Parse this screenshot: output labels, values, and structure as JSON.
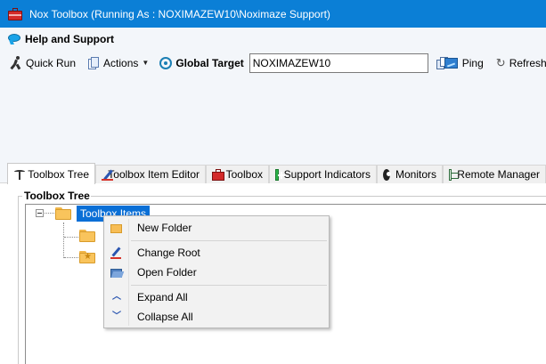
{
  "window": {
    "title": "Nox Toolbox (Running As : NOXIMAZEW10\\Noximaze Support)"
  },
  "menubar": {
    "help_label": "Help and Support"
  },
  "toolbar": {
    "quick_run": "Quick Run",
    "actions": "Actions",
    "global_target_label": "Global Target",
    "global_target_value": "NOXIMAZEW10",
    "ping": "Ping",
    "refresh": "Refresh"
  },
  "tabs": [
    {
      "label": "Toolbox Tree",
      "icon": "palm-tree-icon",
      "active": true
    },
    {
      "label": "Toolbox Item Editor",
      "icon": "pencil-icon"
    },
    {
      "label": "Toolbox",
      "icon": "toolbox-icon"
    },
    {
      "label": "Support Indicators",
      "icon": "plus-icon"
    },
    {
      "label": "Monitors",
      "icon": "gear-icon"
    },
    {
      "label": "Remote Manager",
      "icon": "document-icon"
    }
  ],
  "panel": {
    "title": "Toolbox Tree"
  },
  "tree": {
    "root_label": "Toolbox Items"
  },
  "context_menu": {
    "items": [
      {
        "label": "New Folder",
        "icon": "folder-icon"
      },
      {
        "label": "Change Root",
        "icon": "pencil-icon"
      },
      {
        "label": "Open Folder",
        "icon": "open-folder-icon"
      },
      {
        "label": "Expand All",
        "icon": "chevron-up-icon"
      },
      {
        "label": "Collapse All",
        "icon": "chevron-down-icon"
      }
    ]
  }
}
